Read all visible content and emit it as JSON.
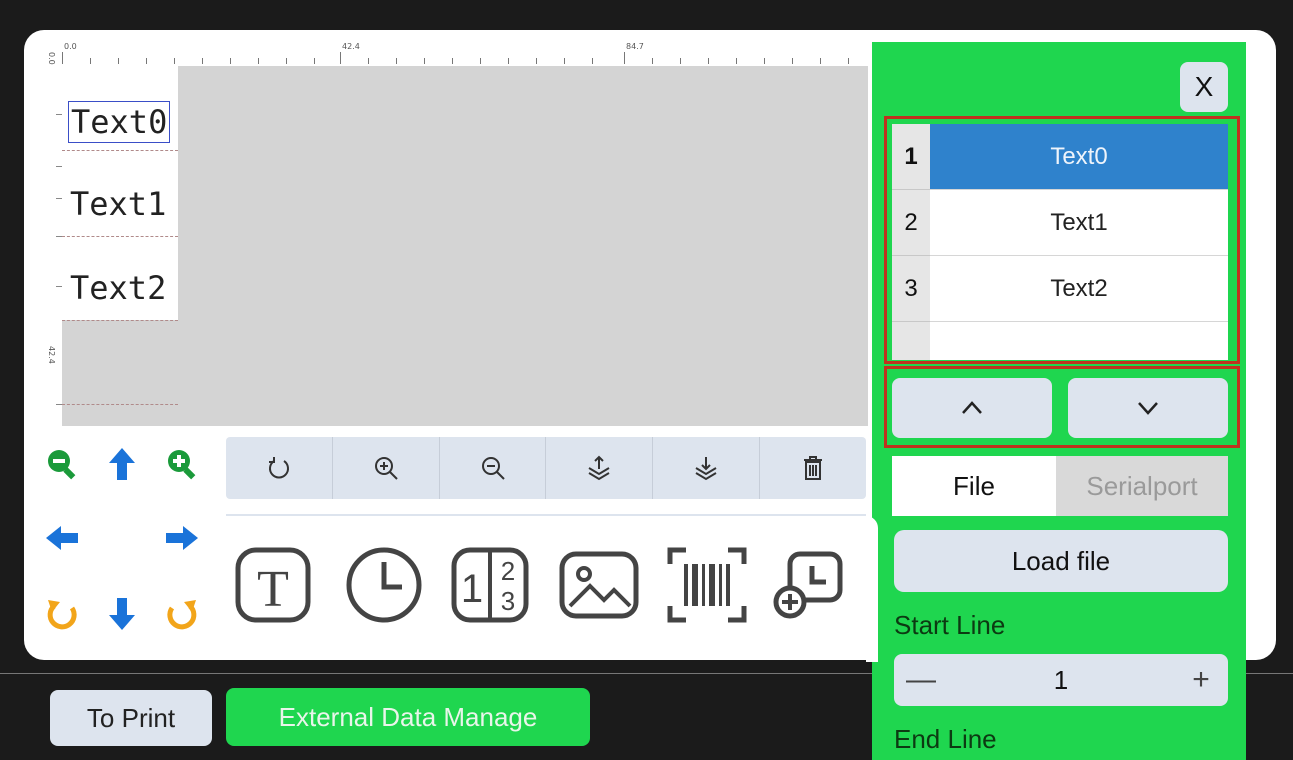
{
  "ruler": {
    "top_labels": [
      "0.0",
      "42.4",
      "84.7"
    ],
    "left_labels": [
      "0.0",
      "42.4"
    ]
  },
  "canvas": {
    "items": [
      "Text0",
      "Text1",
      "Text2"
    ],
    "selected_index": 0
  },
  "controls": {
    "icons": [
      "zoom-out-icon",
      "arrow-up-icon",
      "zoom-in-icon",
      "arrow-left-icon",
      "arrow-right-icon",
      "rotate-ccw-icon",
      "arrow-down-icon",
      "rotate-cw-icon"
    ],
    "colors": {
      "green": "#1a9a3a",
      "blue": "#1a73d9",
      "orange": "#f2a51a"
    }
  },
  "toolbar": {
    "icons": [
      "reset-icon",
      "zoom-in-icon",
      "zoom-out-icon",
      "layer-up-icon",
      "layer-down-icon",
      "delete-icon"
    ]
  },
  "insert": {
    "icons": [
      "text-tool-icon",
      "clock-icon",
      "counter-icon",
      "image-icon",
      "barcode-icon",
      "shift-code-icon"
    ]
  },
  "bottom": {
    "print_label": "To Print",
    "external_label": "External Data Manage"
  },
  "panel": {
    "close_label": "X",
    "rows": [
      {
        "num": "1",
        "label": "Text0",
        "active": true
      },
      {
        "num": "2",
        "label": "Text1",
        "active": false
      },
      {
        "num": "3",
        "label": "Text2",
        "active": false
      }
    ],
    "up_icon": "chevron-up-icon",
    "down_icon": "chevron-down-icon",
    "tab_file": "File",
    "tab_serial": "Serialport",
    "load_label": "Load file",
    "start_line_label": "Start Line",
    "start_line_value": "1",
    "minus_label": "—",
    "plus_label": "+",
    "end_line_label": "End Line",
    "colors": {
      "panel": "#1fd64f",
      "highlight": "#c0321e",
      "selected": "#2f82cc"
    }
  }
}
